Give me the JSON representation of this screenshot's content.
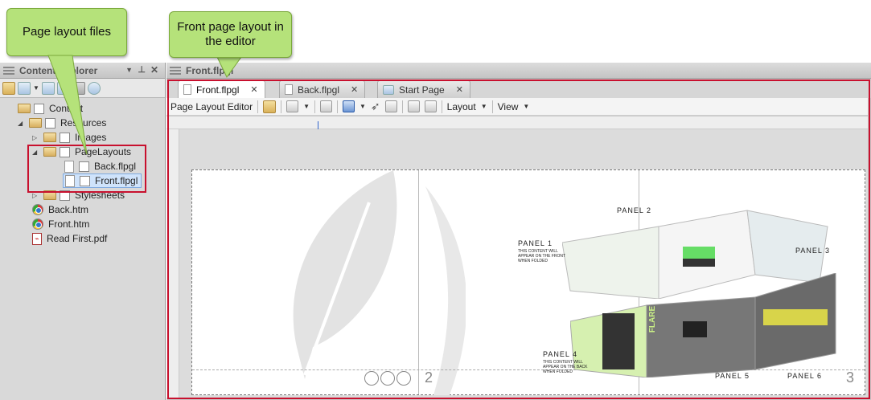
{
  "callouts": {
    "files": "Page layout files",
    "editor": "Front page layout in the editor"
  },
  "left_panel": {
    "title": "Content Explorer",
    "tree": [
      {
        "label": "Content",
        "type": "folder",
        "expanded": true
      },
      {
        "label": "Resources",
        "type": "folder",
        "expanded": true
      },
      {
        "label": "Images",
        "type": "folder",
        "expanded": false
      },
      {
        "label": "PageLayouts",
        "type": "folder",
        "expanded": true
      },
      {
        "label": "Back.flpgl",
        "type": "file"
      },
      {
        "label": "Front.flpgl",
        "type": "file",
        "selected": true
      },
      {
        "label": "Stylesheets",
        "type": "folder",
        "expanded": false
      },
      {
        "label": "Back.htm",
        "type": "html"
      },
      {
        "label": "Front.htm",
        "type": "html"
      },
      {
        "label": "Read First.pdf",
        "type": "pdf"
      }
    ]
  },
  "editor": {
    "window_title": "Front.flpgl",
    "tabs": [
      {
        "label": "Front.flpgl",
        "active": true
      },
      {
        "label": "Back.flpgl",
        "active": false
      },
      {
        "label": "Start Page",
        "active": false
      }
    ],
    "toolbar": {
      "label": "Page Layout Editor",
      "layout_menu": "Layout",
      "view_menu": "View"
    },
    "page": {
      "panel_labels": [
        "PANEL 1",
        "PANEL 2",
        "PANEL 3",
        "PANEL 4",
        "PANEL 5",
        "PANEL 6"
      ],
      "panel1_note": "THIS CONTENT WILL APPEAR ON THE FRONT WHEN FOLDED",
      "panel4_note": "THIS CONTENT WILL APPEAR ON THE BACK WHEN FOLDED",
      "page_number_2": "2",
      "page_number_3": "3",
      "flare_text": "FLARE"
    }
  },
  "colors": {
    "callout_bg": "#b5e27a",
    "highlight_red": "#c8102e"
  }
}
